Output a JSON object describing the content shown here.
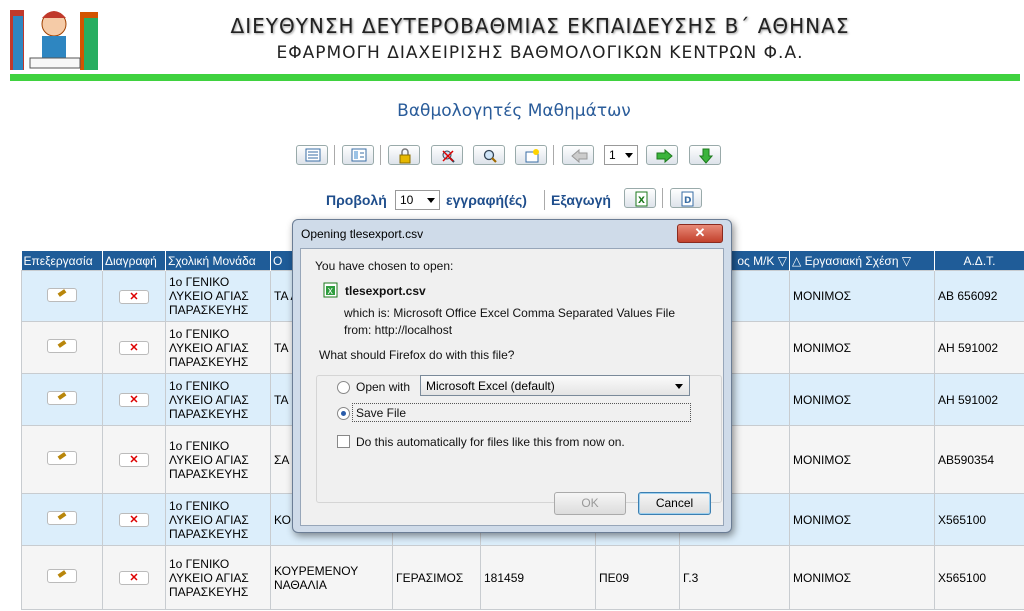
{
  "header": {
    "title": "ΔΙΕΥΘΥΝΣΗ ΔΕΥΤΕΡΟΒΑΘΜΙΑΣ ΕΚΠΑΙΔΕΥΣΗΣ Β΄ ΑΘΗΝΑΣ",
    "subtitle": "ΕΦΑΡΜΟΓΗ ΔΙΑΧΕΙΡΙΣΗΣ ΒΑΘΜΟΛΟΓΙΚΩΝ ΚΕΝΤΡΩΝ Φ.Α.",
    "logo_icon": "student-with-books-logo"
  },
  "page": {
    "title": "Βαθμολογητές Μαθημάτων"
  },
  "toolbar": {
    "icons": [
      "list-view-icon",
      "detail-view-icon",
      "lock-icon",
      "clear-search-icon",
      "search-icon",
      "new-record-icon",
      "previous-page-icon",
      "next-page-icon",
      "last-page-icon"
    ],
    "page_number": "1"
  },
  "view": {
    "label_show": "Προβολή",
    "page_size": "10",
    "label_records": "εγγραφή(ές)",
    "label_export": "Εξαγωγή",
    "export_icons": [
      "excel-export-icon",
      "document-export-icon"
    ]
  },
  "table": {
    "headers": [
      "Επεξεργασία",
      "Διαγραφή",
      "Σχολική Μονάδα",
      "Ο",
      "",
      "",
      "",
      "ος Μ/Κ ▽",
      "△ Εργασιακή Σχέση ▽",
      "Α.Δ.Τ."
    ],
    "rows": [
      {
        "school": "1ο ΓΕΝΙΚΟ ΛΥΚΕΙΟ ΑΓΙΑΣ ΠΑΡΑΣΚΕΥΗΣ",
        "surname": "ΤΑ ΑΣ",
        "name": "",
        "code": "",
        "spec": "",
        "grade": "",
        "relation": "ΜΟΝΙΜΟΣ",
        "adt": "ΑΒ 656092"
      },
      {
        "school": "1ο ΓΕΝΙΚΟ ΛΥΚΕΙΟ ΑΓΙΑΣ ΠΑΡΑΣΚΕΥΗΣ",
        "surname": "ΤΑ ΠΑ",
        "name": "",
        "code": "",
        "spec": "",
        "grade": "",
        "relation": "ΜΟΝΙΜΟΣ",
        "adt": "ΑΗ 591002"
      },
      {
        "school": "1ο ΓΕΝΙΚΟ ΛΥΚΕΙΟ ΑΓΙΑΣ ΠΑΡΑΣΚΕΥΗΣ",
        "surname": "ΤΑ ΠΑ",
        "name": "",
        "code": "",
        "spec": "",
        "grade": "",
        "relation": "ΜΟΝΙΜΟΣ",
        "adt": "ΑΗ 591002"
      },
      {
        "school": "1ο ΓΕΝΙΚΟ ΛΥΚΕΙΟ ΑΓΙΑΣ ΠΑΡΑΣΚΕΥΗΣ",
        "surname": "ΣΑ ΙΩ",
        "name": "",
        "code": "",
        "spec": "",
        "grade": "",
        "relation": "ΜΟΝΙΜΟΣ",
        "adt": "ΑΒ590354"
      },
      {
        "school": "1ο ΓΕΝΙΚΟ ΛΥΚΕΙΟ ΑΓΙΑΣ ΠΑΡΑΣΚΕΥΗΣ",
        "surname": "ΚΟ ΝΑ",
        "name": "",
        "code": "",
        "spec": "",
        "grade": "",
        "relation": "ΜΟΝΙΜΟΣ",
        "adt": "Χ565100"
      },
      {
        "school": "1ο ΓΕΝΙΚΟ ΛΥΚΕΙΟ ΑΓΙΑΣ ΠΑΡΑΣΚΕΥΗΣ",
        "surname": "ΚΟΥΡΕΜΕΝΟΥ ΝΑΘΑΛΙΑ",
        "name": "ΓΕΡΑΣΙΜΟΣ",
        "code": "181459",
        "spec": "ΠΕ09",
        "grade": "Γ.3",
        "relation": "ΜΟΝΙΜΟΣ",
        "adt": "Χ565100"
      }
    ],
    "delete_glyph": "✕"
  },
  "dialog": {
    "title": "Opening tlesexport.csv",
    "close_glyph": "✕",
    "chosen_label": "You have chosen to open:",
    "filename": "tlesexport.csv",
    "which_is": "which is:  Microsoft Office Excel Comma Separated Values File",
    "from": "from:  http://localhost",
    "question": "What should Firefox do with this file?",
    "open_with_label": "Open with",
    "open_with_value": "Microsoft Excel (default)",
    "save_file_label": "Save File",
    "auto_label": "Do this automatically for files like this from now on.",
    "ok_label": "OK",
    "cancel_label": "Cancel"
  }
}
